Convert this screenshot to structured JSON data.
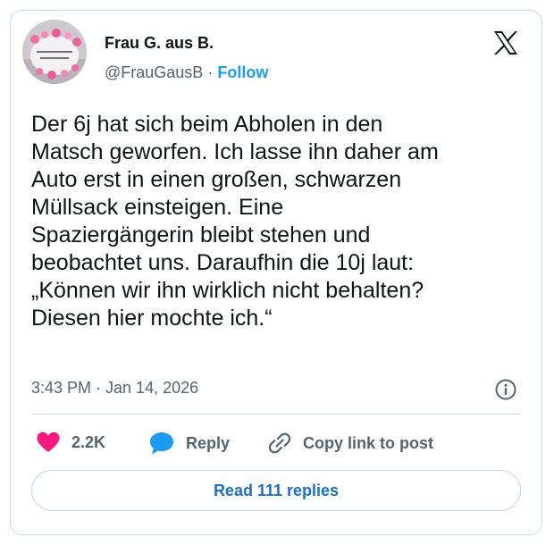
{
  "author": {
    "display_name": "Frau G. aus B.",
    "handle": "@FrauGausB",
    "separator": "·",
    "follow_label": "Follow",
    "avatar_text": "ICH BIN NUR ZUM SHOPPEN HIER"
  },
  "tweet": {
    "text": "Der 6j hat sich beim Abholen in den\nMatsch geworfen. Ich lasse ihn daher am\nAuto erst in einen großen, schwarzen\nMüllsack einsteigen. Eine\nSpaziergängerin bleibt stehen und\nbeobachtet uns. Daraufhin die 10j laut:\n„Können wir ihn wirklich nicht behalten?\nDiesen hier mochte ich.“",
    "timestamp": "3:43 PM · Jan 14, 2026"
  },
  "actions": {
    "like_count": "2.2K",
    "reply_label": "Reply",
    "copy_label": "Copy link to post"
  },
  "read_replies_label": "Read 111 replies",
  "colors": {
    "accent": "#1d9bf0",
    "heart": "#f91880",
    "text": "#0f1419",
    "muted": "#536471",
    "border": "#cfd9de"
  },
  "icons": [
    "x-logo-icon",
    "info-icon",
    "heart-icon",
    "reply-bubble-icon",
    "link-icon"
  ]
}
